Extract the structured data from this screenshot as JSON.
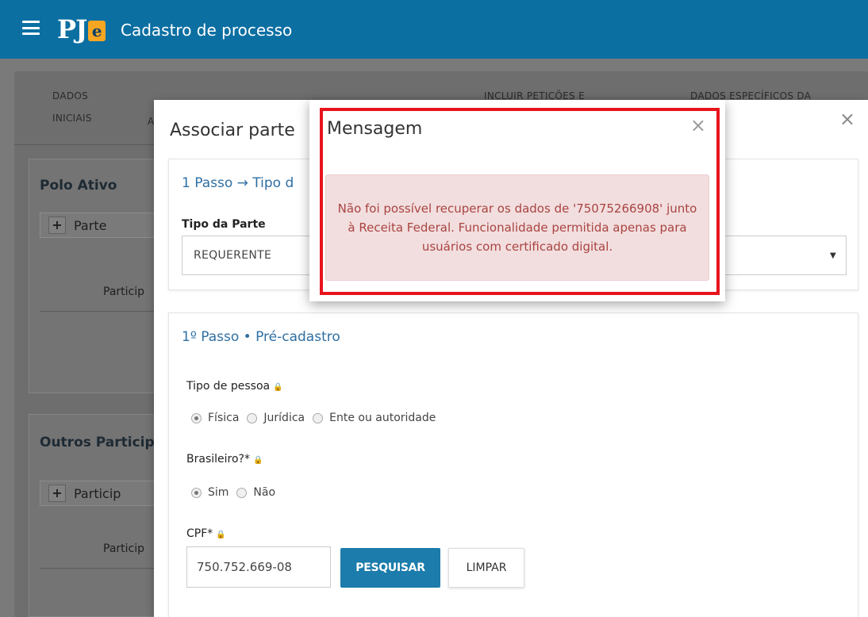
{
  "header": {
    "logo_text": "PJ",
    "logo_e": "e",
    "title": "Cadastro de processo"
  },
  "background": {
    "tabs": [
      {
        "line1": "DADOS",
        "line2": "INICIAIS"
      },
      {
        "line1": "A",
        "line2": ""
      },
      {
        "line1": "INCLUIR PETIÇÕES E",
        "line2": ""
      },
      {
        "line1": "DADOS ESPECÍFICOS DA",
        "line2": ""
      }
    ],
    "polo_ativo": {
      "title": "Polo Ativo",
      "add_label": "Parte",
      "column": "Particip"
    },
    "outros": {
      "title": "Outros Particip",
      "add_label": "Particip",
      "column": "Particip"
    }
  },
  "modal": {
    "title": "Associar parte",
    "close": "×",
    "step1": {
      "title": "1 Passo → Tipo d",
      "tipo_parte_label": "Tipo da Parte",
      "tipo_parte_value": "REQUERENTE",
      "arrow": "▼"
    },
    "step2": {
      "title": "1º Passo • Pré-cadastro",
      "tipo_pessoa_label": "Tipo de pessoa",
      "tipo_pessoa_options": [
        "Física",
        "Jurídica",
        "Ente ou autoridade"
      ],
      "tipo_pessoa_selected": "Física",
      "brasileiro_label": "Brasileiro?*",
      "brasileiro_options": [
        "Sim",
        "Não"
      ],
      "brasileiro_selected": "Sim",
      "cpf_label": "CPF*",
      "cpf_value": "750.752.669-08",
      "search_button": "PESQUISAR",
      "clear_button": "LIMPAR"
    }
  },
  "message": {
    "title": "Mensagem",
    "close": "×",
    "text": "Não foi possível recuperar os dados de '75075266908' junto à Receita Federal. Funcionalidade permitida apenas para usuários com certificado digital."
  },
  "colors": {
    "header": "#0b6fa2",
    "primary_button": "#1c7cab",
    "alert_bg": "#f2dede",
    "alert_text": "#a94442",
    "highlight": "#e8141c"
  }
}
